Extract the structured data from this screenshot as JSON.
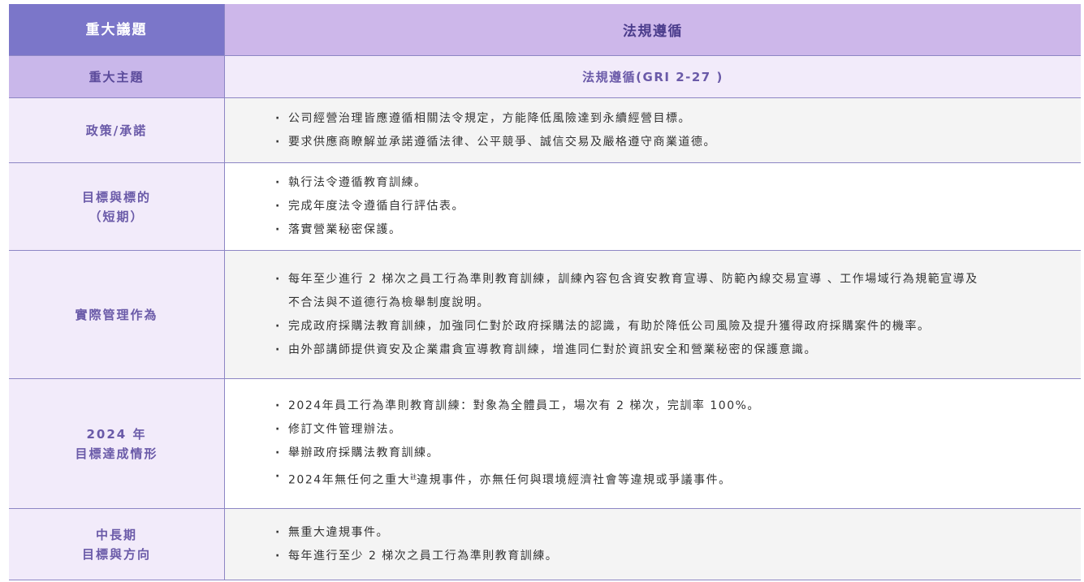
{
  "header": {
    "left": "重大議題",
    "right": "法規遵循"
  },
  "subheader": {
    "left": "重大主題",
    "right": "法規遵循(GRI 2-27 )"
  },
  "rows": [
    {
      "label": [
        "政策/承諾"
      ],
      "items": [
        "公司經營治理皆應遵循相關法令規定，方能降低風險達到永續經營目標。",
        "要求供應商瞭解並承諾遵循法律、公平競爭、誠信交易及嚴格遵守商業道德。"
      ]
    },
    {
      "label": [
        "目標與標的",
        "（短期）"
      ],
      "items": [
        "執行法令遵循教育訓練。",
        "完成年度法令遵循自行評估表。",
        "落實營業秘密保護。"
      ]
    },
    {
      "label": [
        "實際管理作為"
      ],
      "items": [
        "每年至少進行 2 梯次之員工行為準則教育訓練，訓練內容包含資安教育宣導、防範內線交易宣導 、工作場域行為規範宣導及",
        "不合法與不道德行為檢舉制度說明。",
        "完成政府採購法教育訓練，加強同仁對於政府採購法的認識，有助於降低公司風險及提升獲得政府採購案件的機率。",
        "由外部講師提供資安及企業肅貪宣導教育訓練，增進同仁對於資訊安全和營業秘密的保護意識。"
      ]
    },
    {
      "label": [
        "2024 年",
        "目標達成情形"
      ],
      "items": [
        "2024年員工行為準則教育訓練：對象為全體員工，場次有 2 梯次，完訓率 100%。",
        "修訂文件管理辦法。",
        "舉辦政府採購法教育訓練。",
        "2024年無任何之重大",
        "註",
        "違規事件，亦無任何與環境經濟社會等違規或爭議事件。"
      ]
    },
    {
      "label": [
        "中長期",
        "目標與方向"
      ],
      "items": [
        "無重大違規事件。",
        "每年進行至少 2 梯次之員工行為準則教育訓練。"
      ]
    }
  ]
}
